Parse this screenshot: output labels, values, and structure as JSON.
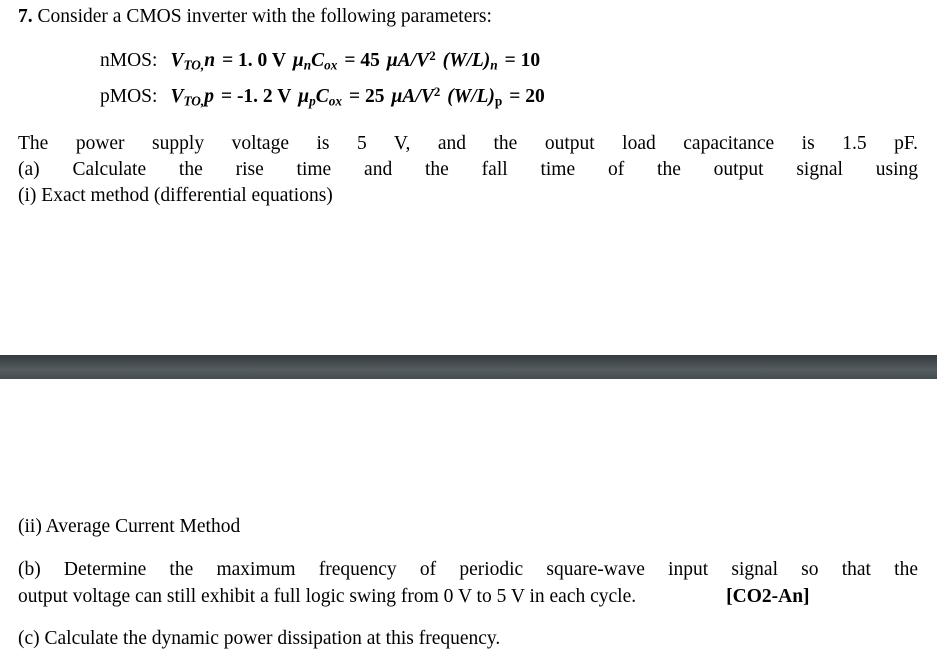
{
  "document": {
    "question_number": "7.",
    "stem": "Consider a CMOS inverter with the following parameters:",
    "parameters": {
      "nmos": {
        "device_label": "nMOS:",
        "vto_symbol": "V",
        "vto_sub": "TO,",
        "vto_device": "n",
        "vto_eq": "= 1. 0 V",
        "mu_symbol": "μ",
        "mu_sub": "n",
        "cox_symbol": "C",
        "cox_sub": "ox",
        "cox_eq": "= 45",
        "cox_unit_mu": "μA/V",
        "cox_unit_exp": "2",
        "wl_open": "(W/L)",
        "wl_sub": "n",
        "wl_eq": "= 10"
      },
      "pmos": {
        "device_label": "pMOS:",
        "vto_symbol": "V",
        "vto_sub": "TO,",
        "vto_device": "p",
        "vto_eq": "= -1. 2 V",
        "mu_symbol": "μ",
        "mu_sub": "p",
        "cox_symbol": "C",
        "cox_sub": "ox",
        "cox_eq": "= 25",
        "cox_unit_mu": "μA/V",
        "cox_unit_exp": "2",
        "wl_open": "(W/L)",
        "wl_sub": "p",
        "wl_eq": "= 20"
      }
    },
    "supply_paragraph": "The power supply voltage is 5 V, and the output load capacitance is 1.5 pF.",
    "part_a": "(a) Calculate the rise time and the fall time of the output signal using",
    "part_a_i": "(i) Exact method (differential equations)",
    "part_a_ii": "(ii) Average Current Method",
    "part_b_line1": "(b) Determine the maximum frequency of periodic square-wave input signal so that the",
    "part_b_line2": "output voltage can still exhibit a full logic swing from 0 V to 5 V in each cycle.",
    "co_tag": "[CO2-An]",
    "part_c": "(c) Calculate the dynamic power dissipation at this frequency."
  },
  "colors": {
    "page_background": "#ffffff",
    "text": "#000000",
    "band_top": "#353b3e",
    "band_middle": "#565d60",
    "band_bottom": "#454c4f"
  }
}
